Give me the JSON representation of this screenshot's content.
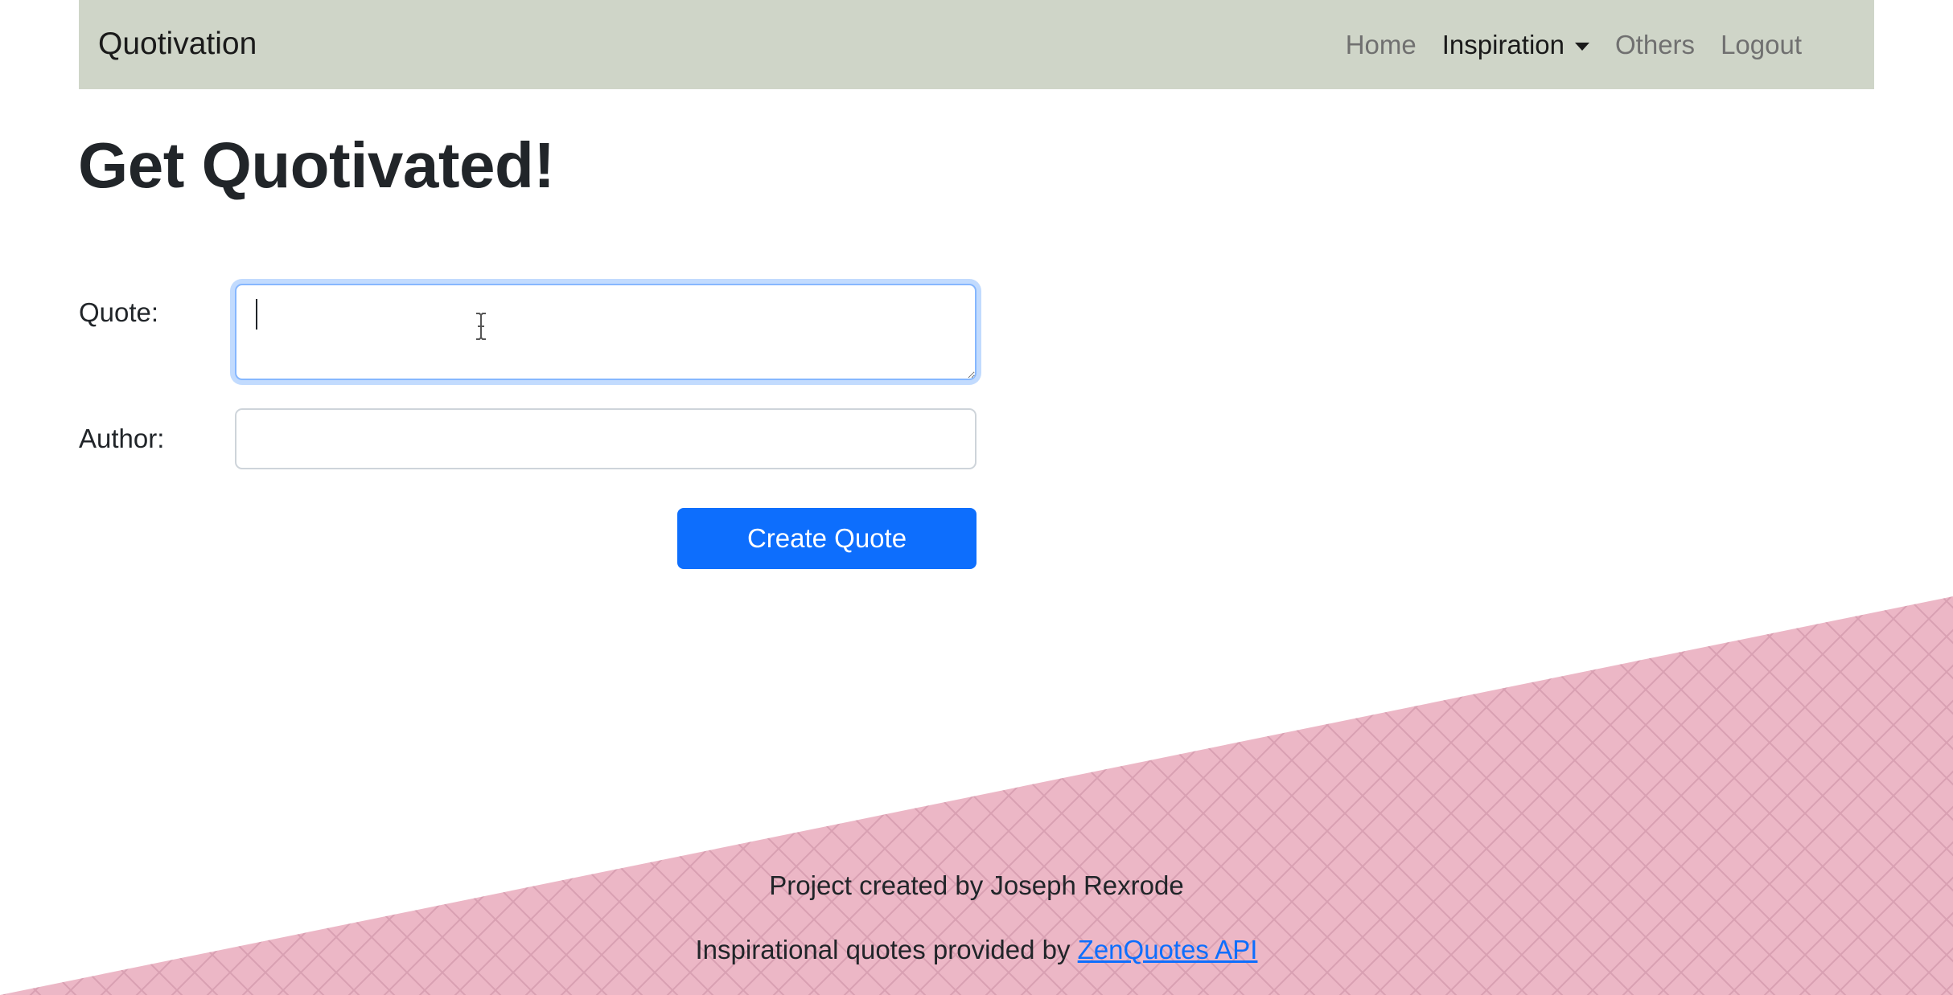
{
  "navbar": {
    "brand": "Quotivation",
    "links": [
      {
        "label": "Home"
      },
      {
        "label": "Inspiration"
      },
      {
        "label": "Others"
      },
      {
        "label": "Logout"
      }
    ]
  },
  "main": {
    "title": "Get Quotivated!",
    "form": {
      "quote_label": "Quote:",
      "quote_value": "",
      "author_label": "Author:",
      "author_value": "",
      "submit_label": "Create Quote"
    }
  },
  "footer": {
    "credit": "Project created by Joseph Rexrode",
    "api_prefix": "Inspirational quotes provided by ",
    "api_link": "ZenQuotes API"
  },
  "colors": {
    "navbar_bg": "#cfd5c8",
    "accent": "#0d6efd",
    "footer_pink": "#ecb7c6"
  }
}
